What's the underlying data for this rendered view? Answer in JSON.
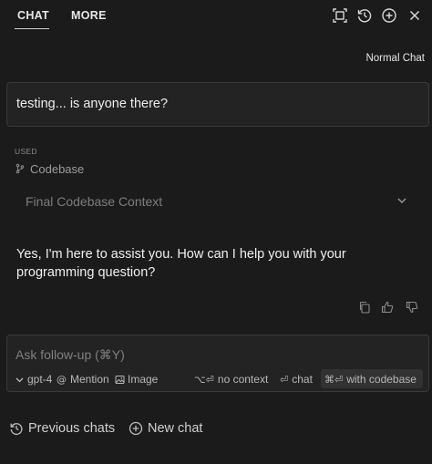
{
  "tabs": [
    {
      "label": "CHAT",
      "active": true
    },
    {
      "label": "MORE",
      "active": false
    }
  ],
  "header_icons": [
    "expand-icon",
    "history-icon",
    "add-circle-icon",
    "close-icon"
  ],
  "mode_label": "Normal Chat",
  "user_message": "testing... is anyone there?",
  "used": {
    "label": "USED",
    "item": "Codebase",
    "context_label": "Final Codebase Context"
  },
  "assistant_message": "Yes, I'm here to assist you. How can I help you with your programming question?",
  "message_actions": [
    "copy-icon",
    "thumbs-up-icon",
    "thumbs-down-icon"
  ],
  "followup": {
    "placeholder": "Ask follow-up (⌘Y)",
    "value": ""
  },
  "toolbar": {
    "model": "gpt-4",
    "mention": "Mention",
    "image": "Image",
    "no_context_key": "⌥⏎",
    "no_context": "no context",
    "chat_key": "⏎",
    "chat": "chat",
    "codebase_key": "⌘⏎",
    "with_codebase": "with codebase"
  },
  "bottom": {
    "previous_chats": "Previous chats",
    "new_chat": "New chat"
  },
  "colors": {
    "background": "#1b1b1b",
    "panel": "#232323",
    "border": "#3a3a3a",
    "text": "#f0f0f0",
    "muted": "#808080"
  }
}
